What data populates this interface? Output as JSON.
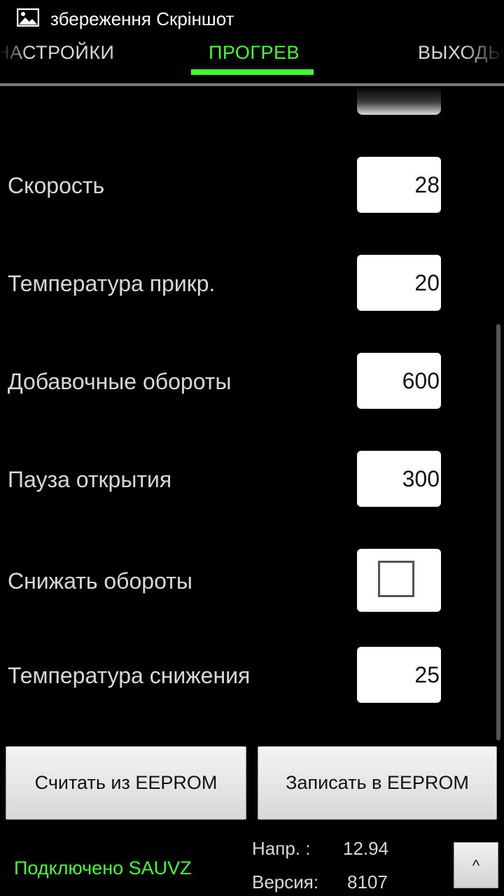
{
  "status_bar": {
    "notification": "збереження Скріншот",
    "icon": "image-icon"
  },
  "tabs": [
    {
      "label": "НАСТРОЙКИ"
    },
    {
      "label": "ПРОГРЕВ"
    },
    {
      "label": "ВЫХОДЫ"
    }
  ],
  "active_tab": "ПРОГРЕВ",
  "settings": [
    {
      "label": "Скорость",
      "value": "28"
    },
    {
      "label": "Температура прикр.",
      "value": "20"
    },
    {
      "label": "Добавочные обороты",
      "value": "600"
    },
    {
      "label": "Пауза открытия",
      "value": "300"
    },
    {
      "label": "Снижать обороты",
      "checked": false
    },
    {
      "label": "Температура снижения",
      "value": "25"
    }
  ],
  "buttons": {
    "read": "Считать из EEPROM",
    "write": "Записать в EEPROM",
    "up": "^"
  },
  "footer": {
    "connection": "Подключено SAUVZ",
    "voltage_label": "Напр. :",
    "voltage_value": "12.94",
    "version_label": "Версия:",
    "version_value": "8107"
  },
  "colors": {
    "accent": "#3dff2e",
    "background": "#000000"
  }
}
